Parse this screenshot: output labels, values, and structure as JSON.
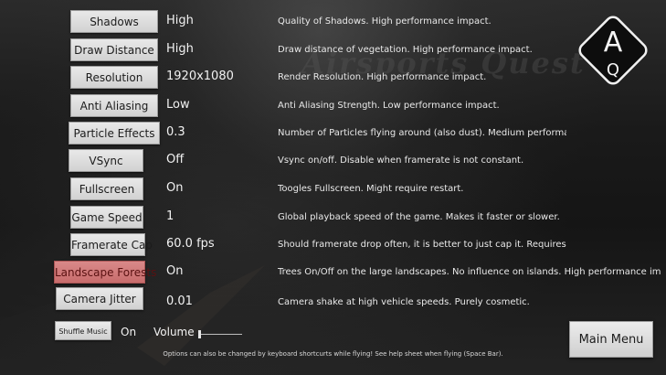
{
  "watermark": "Airsports Quest",
  "logo": {
    "top_letter": "A",
    "bottom_letter": "Q",
    "icon": "aq-logo-diamond"
  },
  "options": [
    {
      "label": "Shadows",
      "value": "High",
      "desc": "Quality of Shadows. High performance impact."
    },
    {
      "label": "Draw Distance",
      "value": "High",
      "desc": "Draw distance of vegetation. High performance impact."
    },
    {
      "label": "Resolution",
      "value": "1920x1080",
      "desc": "Render Resolution. High performance impact."
    },
    {
      "label": "Anti Aliasing",
      "value": "Low",
      "desc": "Anti Aliasing Strength. Low performance impact."
    },
    {
      "label": "Particle Effects",
      "value": "0.3",
      "desc": "Number of Particles flying around (also dust). Medium performance impac"
    },
    {
      "label": "VSync",
      "value": "Off",
      "desc": "Vsync on/off. Disable when framerate is not constant."
    },
    {
      "label": "Fullscreen",
      "value": "On",
      "desc": "Toogles Fullscreen. Might require restart."
    },
    {
      "label": "Game Speed",
      "value": "1",
      "desc": "Global playback speed of the game. Makes it faster or slower."
    },
    {
      "label": "Framerate Cap",
      "value": "60.0 fps",
      "desc": "Should framerate drop often, it is better to just cap it. Requires restar"
    },
    {
      "label": "Landscape Forests",
      "value": "On",
      "desc": "Trees On/Off on the large landscapes. No influence on islands. High performance impact."
    },
    {
      "label": "Camera Jitter",
      "value": "0.01",
      "desc": "Camera shake at high vehicle speeds. Purely cosmetic."
    }
  ],
  "audio": {
    "shuffle_label": "Shuffle Music",
    "shuffle_value": "On",
    "volume_label": "Volume",
    "volume_level": 0.0
  },
  "main_menu_label": "Main Menu",
  "footer_note": "Options can also be changed by keyboard shortcurts while flying! See help sheet when flying (Space Bar).",
  "colors": {
    "button_face": "#dcdcdc",
    "active_button": "#cf7777",
    "text": "#f2f2f2"
  }
}
